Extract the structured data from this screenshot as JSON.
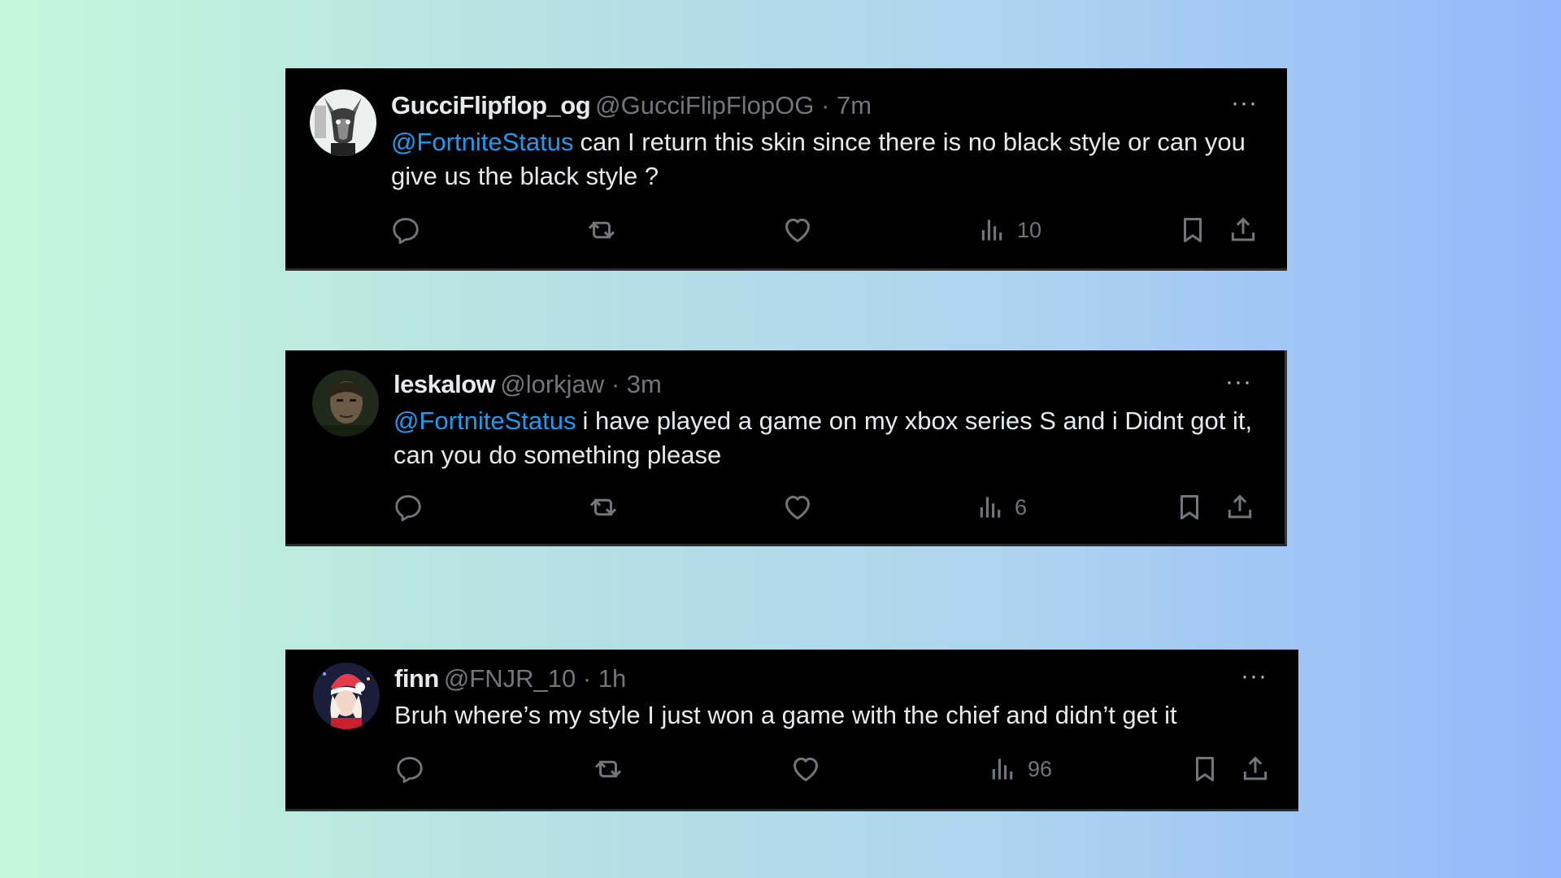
{
  "tweets": [
    {
      "name": "GucciFlipflop_og",
      "handle": "@GucciFlipFlopOG",
      "separator": "·",
      "time": "7m",
      "mention": "@FortniteStatus",
      "text": "can I return this skin since there is no black style or can you give us the black style ?",
      "views": "10",
      "more": "···"
    },
    {
      "name": "leskalow",
      "handle": "@lorkjaw",
      "separator": "·",
      "time": "3m",
      "mention": "@FortniteStatus",
      "text": "i have played a game on my xbox series S and i Didnt got it, can you do something please",
      "views": "6",
      "more": "···"
    },
    {
      "name": "finn",
      "handle": "@FNJR_10",
      "separator": "·",
      "time": "1h",
      "text": "Bruh where’s my style I just won a game with the chief and didn’t get it",
      "views": "96",
      "more": "···"
    }
  ],
  "icons": [
    "reply-icon",
    "retweet-icon",
    "like-icon",
    "views-icon",
    "bookmark-icon",
    "share-icon"
  ],
  "colors": {
    "card_background": "#000000",
    "mention": "#1d9bf0",
    "primary_text": "#e7e9ea",
    "secondary_text": "#71767b"
  }
}
